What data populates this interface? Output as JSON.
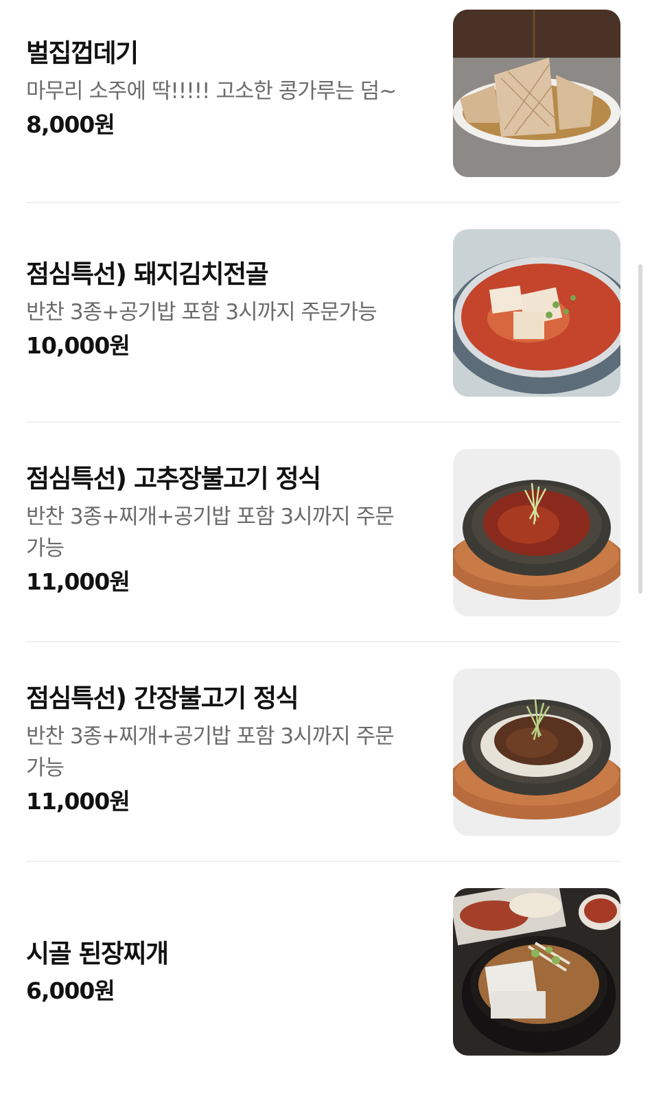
{
  "menu": {
    "items": [
      {
        "name": "벌집껍데기",
        "description": "마무리 소주에 딱!!!!! 고소한 콩가루는 덤~",
        "price": "8,000원",
        "image_icon": "pork-skin-dish-photo"
      },
      {
        "name": "점심특선) 돼지김치전골",
        "description": "반찬 3종+공기밥 포함 3시까지 주문가능",
        "price": "10,000원",
        "image_icon": "kimchi-stew-photo"
      },
      {
        "name": "점심특선) 고추장불고기 정식",
        "description": "반찬 3종+찌개+공기밥 포함 3시까지 주문 가능",
        "price": "11,000원",
        "image_icon": "gochujang-bulgogi-photo"
      },
      {
        "name": "점심특선) 간장불고기 정식",
        "description": "반찬 3종+찌개+공기밥 포함 3시까지 주문 가능",
        "price": "11,000원",
        "image_icon": "soy-bulgogi-photo"
      },
      {
        "name": "시골 된장찌개",
        "description": "",
        "price": "6,000원",
        "image_icon": "doenjang-stew-photo"
      }
    ]
  },
  "colors": {
    "text_primary": "#111111",
    "text_secondary": "#6b6b6b",
    "divider": "#f0f0f0"
  }
}
